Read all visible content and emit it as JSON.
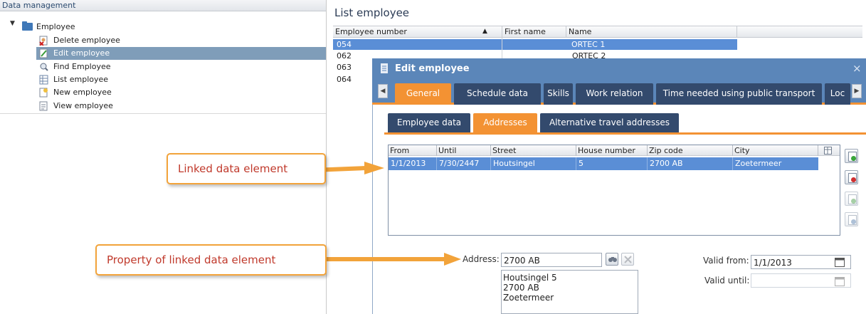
{
  "left_panel": {
    "header": "Data management",
    "root_label": "Employee",
    "items": [
      {
        "label": "Delete employee",
        "icon": "delete-employee-icon",
        "selected": false
      },
      {
        "label": "Edit employee",
        "icon": "edit-employee-icon",
        "selected": true
      },
      {
        "label": "Find Employee",
        "icon": "find-employee-icon",
        "selected": false
      },
      {
        "label": "List employee",
        "icon": "list-employee-icon",
        "selected": false
      },
      {
        "label": "New employee",
        "icon": "new-employee-icon",
        "selected": false
      },
      {
        "label": "View employee",
        "icon": "view-employee-icon",
        "selected": false
      }
    ]
  },
  "list": {
    "title": "List employee",
    "columns": [
      "Employee number",
      "First name",
      "Name"
    ],
    "sort_indicator": "▲",
    "rows": [
      {
        "number": "054",
        "first_name": "",
        "name": "ORTEC 1"
      },
      {
        "number": "062",
        "first_name": "",
        "name": "ORTEC 2"
      },
      {
        "number": "063"
      },
      {
        "number": "064"
      }
    ]
  },
  "dialog": {
    "title": "Edit employee",
    "close_glyph": "×",
    "tabs": [
      "General",
      "Schedule data",
      "Skills",
      "Work relation",
      "Time needed using public transport",
      "Loc"
    ],
    "active_tab": "General",
    "subtabs": [
      "Employee data",
      "Addresses",
      "Alternative travel addresses"
    ],
    "active_subtab": "Addresses",
    "address_grid": {
      "columns": [
        "From",
        "Until",
        "Street",
        "House number",
        "Zip code",
        "City"
      ],
      "rows": [
        {
          "from": "1/1/2013",
          "until": "7/30/2447",
          "street": "Houtsingel",
          "house_number": "5",
          "zip": "2700 AB",
          "city": "Zoetermeer"
        }
      ]
    },
    "form": {
      "address_label": "Address:",
      "address_value": "2700 AB",
      "address_lines": [
        "Houtsingel 5",
        "2700 AB",
        "Zoetermeer"
      ],
      "valid_from_label": "Valid from:",
      "valid_from_value": "1/1/2013",
      "valid_until_label": "Valid until:",
      "valid_until_value": ""
    }
  },
  "callouts": {
    "linked": "Linked data element",
    "property": "Property of linked data element"
  },
  "colors": {
    "accent_orange": "#f39233",
    "dialog_blue": "#5b86b9",
    "tab_dark": "#334a6d",
    "selection_blue": "#5a8ed6",
    "callout_text": "#c0392b"
  }
}
